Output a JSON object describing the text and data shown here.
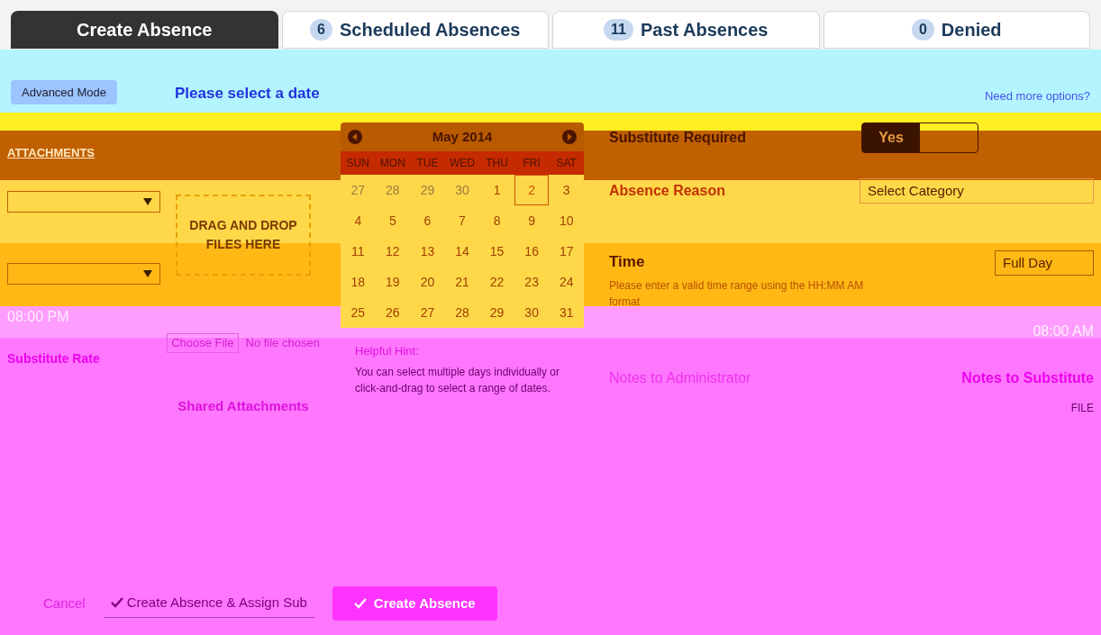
{
  "tabs": [
    {
      "label": "Create Absence",
      "selected": true
    },
    {
      "label": "Scheduled Absences",
      "count": "6",
      "selected": false
    },
    {
      "label": "Past Absences",
      "count": "11",
      "selected": false
    },
    {
      "label": "Denied",
      "count": "0",
      "selected": false
    }
  ],
  "header": {
    "title": "Please select a date",
    "left_button": "Advanced Mode",
    "help_link": "Need more options?"
  },
  "attachments": {
    "heading": "ATTACHMENTS",
    "drop_text": "DRAG AND DROP FILES HERE",
    "choose_button": "Choose File",
    "file_status": "No file chosen",
    "shared_heading": "Shared Attachments",
    "file_label": "FILE"
  },
  "left": {
    "time_value": "08:00 PM",
    "rate_label": "Substitute Rate"
  },
  "calendar": {
    "month": "May 2014",
    "weekdays": [
      "SUN",
      "MON",
      "TUE",
      "WED",
      "THU",
      "FRI",
      "SAT"
    ],
    "days": [
      {
        "label": "27",
        "muted": true,
        "selected": false
      },
      {
        "label": "28",
        "muted": true,
        "selected": false
      },
      {
        "label": "29",
        "muted": true,
        "selected": false
      },
      {
        "label": "30",
        "muted": true,
        "selected": false
      },
      {
        "label": "1",
        "muted": false,
        "selected": false
      },
      {
        "label": "2",
        "muted": false,
        "selected": true
      },
      {
        "label": "3",
        "muted": false,
        "selected": false
      },
      {
        "label": "4",
        "muted": false,
        "selected": false
      },
      {
        "label": "5",
        "muted": false,
        "selected": false
      },
      {
        "label": "6",
        "muted": false,
        "selected": false
      },
      {
        "label": "7",
        "muted": false,
        "selected": false
      },
      {
        "label": "8",
        "muted": false,
        "selected": false
      },
      {
        "label": "9",
        "muted": false,
        "selected": false
      },
      {
        "label": "10",
        "muted": false,
        "selected": false
      },
      {
        "label": "11",
        "muted": false,
        "selected": false
      },
      {
        "label": "12",
        "muted": false,
        "selected": false
      },
      {
        "label": "13",
        "muted": false,
        "selected": false
      },
      {
        "label": "14",
        "muted": false,
        "selected": false
      },
      {
        "label": "15",
        "muted": false,
        "selected": false
      },
      {
        "label": "16",
        "muted": false,
        "selected": false
      },
      {
        "label": "17",
        "muted": false,
        "selected": false
      },
      {
        "label": "18",
        "muted": false,
        "selected": false
      },
      {
        "label": "19",
        "muted": false,
        "selected": false
      },
      {
        "label": "20",
        "muted": false,
        "selected": false
      },
      {
        "label": "21",
        "muted": false,
        "selected": false
      },
      {
        "label": "22",
        "muted": false,
        "selected": false
      },
      {
        "label": "23",
        "muted": false,
        "selected": false
      },
      {
        "label": "24",
        "muted": false,
        "selected": false
      },
      {
        "label": "25",
        "muted": false,
        "selected": false
      },
      {
        "label": "26",
        "muted": false,
        "selected": false
      },
      {
        "label": "27",
        "muted": false,
        "selected": false
      },
      {
        "label": "28",
        "muted": false,
        "selected": false
      },
      {
        "label": "29",
        "muted": false,
        "selected": false
      },
      {
        "label": "30",
        "muted": false,
        "selected": false
      },
      {
        "label": "31",
        "muted": false,
        "selected": false
      }
    ]
  },
  "hint": {
    "title": "Helpful Hint:",
    "text": "You can select multiple days individually or click-and-drag to select a range of dates."
  },
  "form": {
    "substitute_label": "Substitute Required",
    "toggle": {
      "label": "Yes",
      "on": true
    },
    "reason_label": "Absence Reason",
    "reason_select": "Select Category",
    "time_label": "Time",
    "time_select": "Full Day",
    "time_help": "Please enter a valid time range using the HH:MM AM format",
    "time_value": "08:00 AM",
    "notes_admin": "Notes to Administrator",
    "notes_sub": "Notes to Substitute"
  },
  "actions": {
    "cancel": "Cancel",
    "assign": "Create Absence & Assign Sub",
    "create": "Create Absence"
  }
}
